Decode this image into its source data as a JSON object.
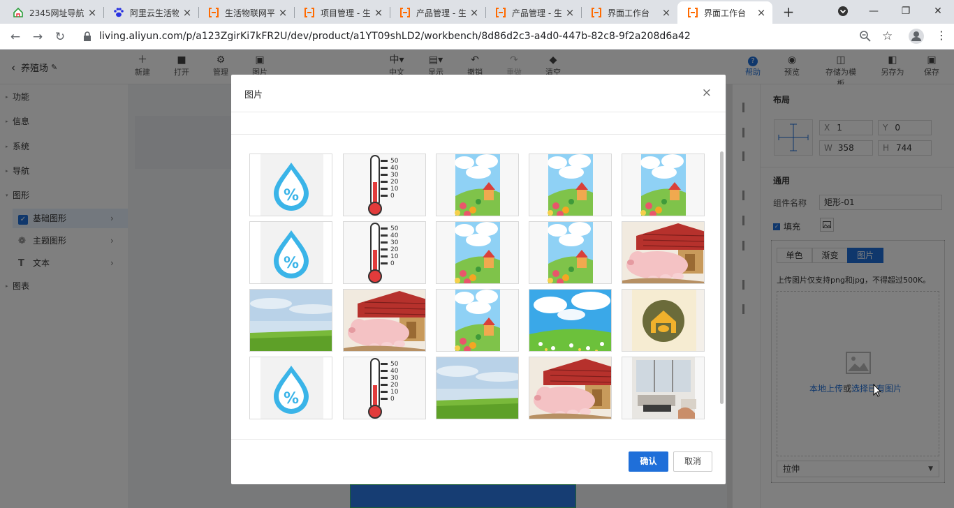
{
  "browser": {
    "tabs": [
      {
        "title": "2345网址导航",
        "favicon": "house-icon",
        "active": false
      },
      {
        "title": "阿里云生活物",
        "favicon": "paw-icon",
        "active": false
      },
      {
        "title": "生活物联网平",
        "favicon": "bracket-icon",
        "active": false
      },
      {
        "title": "项目管理 - 生",
        "favicon": "bracket-icon",
        "active": false
      },
      {
        "title": "产品管理 - 生",
        "favicon": "bracket-icon",
        "active": false
      },
      {
        "title": "产品管理 - 生",
        "favicon": "bracket-icon",
        "active": false
      },
      {
        "title": "界面工作台",
        "favicon": "bracket-icon",
        "active": false
      },
      {
        "title": "界面工作台",
        "favicon": "bracket-icon",
        "active": true
      }
    ],
    "url": "living.aliyun.com/p/a123ZgirKi7kFR2U/dev/product/a1YT09shLD2/workbench/8d86d2c3-a4d0-447b-82c8-9f2a208d6a42"
  },
  "app": {
    "project_name": "养殖场",
    "toolbar_left": [
      {
        "label": "新建",
        "icon": "plus-icon"
      },
      {
        "label": "打开",
        "icon": "folder-icon"
      },
      {
        "label": "管理",
        "icon": "gear-icon"
      },
      {
        "label": "图片",
        "icon": "image-icon"
      }
    ],
    "toolbar_center": [
      {
        "label": "中文",
        "icon": "中▾"
      },
      {
        "label": "显示",
        "icon": "display-icon"
      },
      {
        "label": "撤销",
        "icon": "undo-icon"
      },
      {
        "label": "重做",
        "icon": "redo-icon"
      },
      {
        "label": "清空",
        "icon": "eraser-icon"
      }
    ],
    "toolbar_right": [
      {
        "label": "帮助",
        "icon": "help-icon"
      },
      {
        "label": "预览",
        "icon": "eye-icon"
      },
      {
        "label": "存储为模板",
        "icon": "template-icon"
      },
      {
        "label": "另存为",
        "icon": "save-as-icon"
      },
      {
        "label": "保存",
        "icon": "save-icon"
      }
    ],
    "left_menu": [
      {
        "label": "功能"
      },
      {
        "label": "信息"
      },
      {
        "label": "系统"
      },
      {
        "label": "导航"
      },
      {
        "label": "图形"
      }
    ],
    "left_sub": [
      {
        "label": "基础图形",
        "icon": "checkbox-icon",
        "selected": true
      },
      {
        "label": "主题图形",
        "icon": "flower-icon",
        "selected": false
      },
      {
        "label": "文本",
        "icon": "text-icon",
        "selected": false
      }
    ],
    "left_last": "图表",
    "right_panel": {
      "layout_title": "布局",
      "x": "1",
      "y": "0",
      "w": "358",
      "h": "744",
      "general_title": "通用",
      "component_name_label": "组件名称",
      "component_name": "矩形-01",
      "fill_label": "填充",
      "fill_tabs": [
        "单色",
        "渐变",
        "图片"
      ],
      "upload_hint": "上传图片仅支持png和jpg，不得超过500K。",
      "upload_local": "本地上传",
      "upload_or": "或",
      "upload_choose": "选择已有图片",
      "stretch": "拉伸"
    }
  },
  "dialog": {
    "title": "图片",
    "confirm": "确认",
    "cancel": "取消",
    "images": [
      [
        "humidity-drop-icon",
        "thermometer-icon",
        "cartoon-village-image",
        "cartoon-village-image",
        "cartoon-village-image"
      ],
      [
        "humidity-drop-icon",
        "thermometer-icon",
        "cartoon-village-image",
        "cartoon-village-image",
        "pig-barn-image"
      ],
      [
        "grass-field-image",
        "pig-barn-image",
        "cartoon-village-image",
        "flower-meadow-image",
        "barn-badge-icon"
      ],
      [
        "humidity-drop-icon",
        "thermometer-icon",
        "grass-field-image",
        "pig-barn-image",
        "living-room-image"
      ]
    ]
  }
}
